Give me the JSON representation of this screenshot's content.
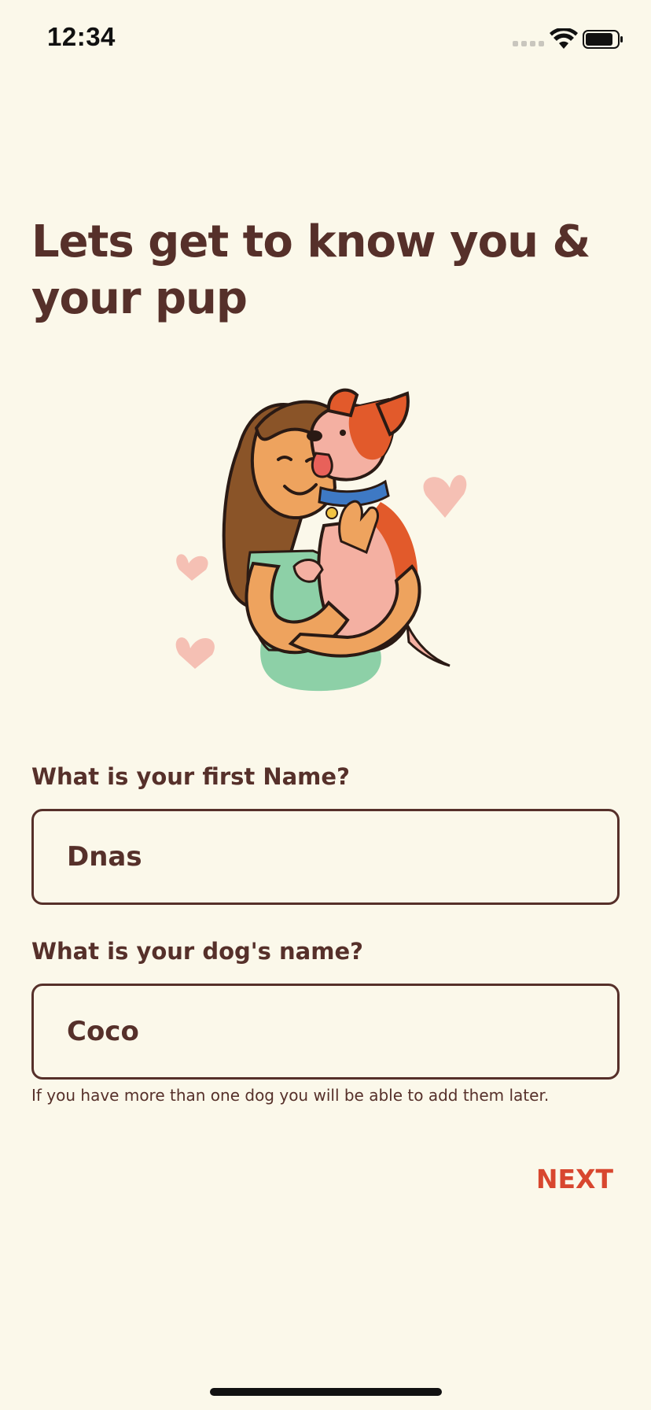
{
  "status_bar": {
    "time": "12:34",
    "icons": [
      "signal-icon",
      "wifi-icon",
      "battery-icon"
    ]
  },
  "onboarding": {
    "title": "Lets get to know you & your pup",
    "illustration": "woman-hugging-dog",
    "first_name": {
      "label": "What is your first Name?",
      "value": "Dnas"
    },
    "dog_name": {
      "label": "What is your dog's name?",
      "value": "Coco",
      "helper": "If you have more than one dog you will be able to add them later."
    },
    "next_label": "NEXT"
  },
  "colors": {
    "background": "#FBF8EA",
    "text": "#56302A",
    "accent": "#D8472F"
  }
}
